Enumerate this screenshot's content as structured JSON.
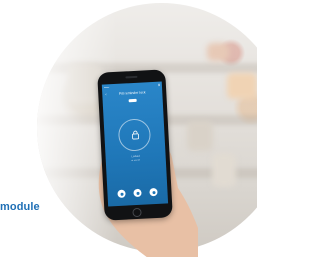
{
  "caption": {
    "text": "module",
    "color": "#1f6fb5"
  },
  "phone_screen": {
    "background_color": "#1f77b8",
    "status_left": "•••••",
    "status_right": "▮",
    "header_title": "Pill reminder lock",
    "back_icon": "back-arrow-icon",
    "center_icon": "lock-icon",
    "caption_line_1": "Locked",
    "caption_line_2": "•• ••• •••",
    "buttons": [
      "unlock-icon",
      "lock-icon",
      "settings-icon"
    ]
  }
}
